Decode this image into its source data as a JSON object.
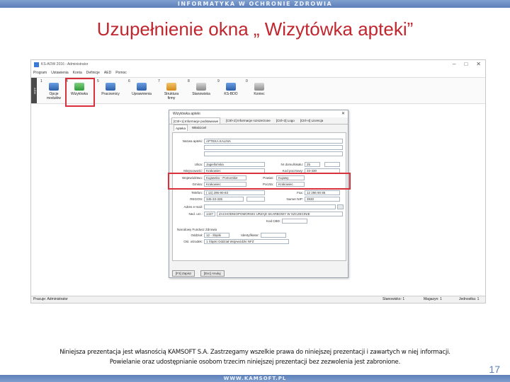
{
  "banner": {
    "top": "INFORMATYKA W OCHRONIE ZDROWIA",
    "bottom": "WWW.KAMSOFT.PL"
  },
  "slide": {
    "title": "Uzupełnienie okna „ Wizytówka apteki”",
    "footnote_line1": "Niniejsza prezentacja jest własnością KAMSOFT S.A. Zastrzegamy wszelkie prawa do niniejszej prezentacji i zawartych w niej informacji.",
    "footnote_line2": "Powielanie oraz udostępnianie osobom trzecim niniejszej prezentacji bez zezwolenia jest zabronione.",
    "page_number": "17"
  },
  "app": {
    "title": "KS-AOW 2016 - Administrator",
    "win_buttons": [
      "–",
      "□",
      "✕"
    ],
    "menu": [
      "Program",
      "Ustawienia",
      "Konta",
      "Definicje",
      "AED",
      "Pomoc"
    ],
    "toolbar_side": "ADM",
    "toolbar": [
      {
        "num": "1",
        "label": "Opcje\nmodułów",
        "icon": "options-icon",
        "color": "g-blue"
      },
      {
        "num": "4",
        "label": "Wizytówka",
        "icon": "business-card-icon",
        "color": "g-green"
      },
      {
        "num": "5",
        "label": "Pracownicy",
        "icon": "employees-icon",
        "color": "g-blue"
      },
      {
        "num": "6",
        "label": "Uprawnienia",
        "icon": "permissions-icon",
        "color": "g-blue"
      },
      {
        "num": "7",
        "label": "Struktura\nfirmy",
        "icon": "company-structure-icon",
        "color": "g-orange"
      },
      {
        "num": "8",
        "label": "Stanowiska",
        "icon": "workstations-icon",
        "color": "g-gray"
      },
      {
        "num": "9",
        "label": "KS-BDO",
        "icon": "bdo-icon",
        "color": "g-blue"
      },
      {
        "num": "0",
        "label": "Koniec",
        "icon": "exit-icon",
        "color": "g-gray"
      }
    ],
    "status": {
      "user": "Pracuje: Administrator",
      "station": "Stanowisko: 1",
      "store": "Magazyn: 1",
      "unit": "Jednostka: 1"
    }
  },
  "dialog": {
    "title": "Wizytówka apteki",
    "close": "✕",
    "tabs": [
      "[Ctrl+1] Informacje podstawowe",
      "[Ctrl+2] Informacje rozszerzone",
      "[Ctrl+3] Logo",
      "[Ctrl+4] Licencja"
    ],
    "subtabs": [
      "Apteka",
      "Właściciel"
    ],
    "fields": {
      "nazwa_label": "Nazwa apteki:",
      "nazwa_value": "APTEKA KALINA",
      "ulica_label": "Ulica:",
      "ulica_value": "Jagiellońska",
      "nr_domu_label": "Nr domu/lokalu:",
      "nr_domu_value": "25",
      "kod_label": "Kod pocztowy:",
      "kod_value": "33-330",
      "miejsc_label": "Miejscowość:",
      "miejsc_value": "Krakowiec",
      "wojew_label": "Województwo:",
      "wojew_value": "Kujawsko - Pomorskie",
      "powiat_label": "Powiat:",
      "powiat_value": "Kujawy",
      "gmina_label": "Gmina:",
      "gmina_value": "Krakowiec",
      "poczta_label": "Poczta:",
      "poczta_value": "Krakowiec",
      "tel_label": "Telefon:",
      "tel_value": "( 12) 296-90-83",
      "fax_label": "Fax:",
      "fax_value": "12 296 90 85",
      "regon_label": "REGON:",
      "regon_value": "345-33-335",
      "nip_label": "Numer NIP:",
      "nip_value": "3930",
      "email_label": "Adres e-mail:",
      "email_value": "",
      "ned_label": "Ned. urz.:",
      "ned_value": "1437",
      "urzad_value": "ZACHODNIOPOMORSKI URZĄD SKARBOWY W SZCZECINIE",
      "kod_cbd_label": "Kod CBD:",
      "kod_cbd_value": ""
    },
    "nfz_section": "Narodowy Fundusz Zdrowia",
    "nfz": {
      "oddzial_label": "Oddział:",
      "oddzial_value": "12 - Śląski",
      "identyfikator_label": "Identyfikator:",
      "identyfikator_value": "",
      "id_label": "Ośr. ośrodek:",
      "id_value": "1 Śląski Oddział Wojewódzki NFZ"
    },
    "buttons": {
      "save": "[F3] Zapisz",
      "cancel": "[Esc] Anuluj"
    }
  }
}
